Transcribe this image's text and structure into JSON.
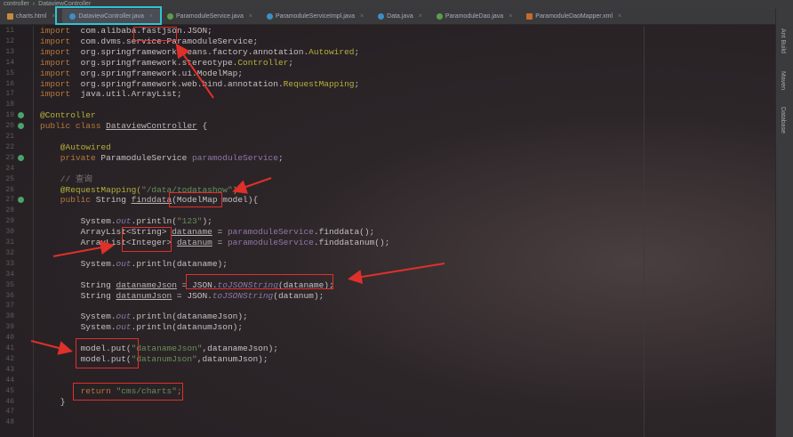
{
  "breadcrumb": [
    "controller",
    "DataviewController"
  ],
  "tabs": [
    {
      "label": "charts.html",
      "icon": "html-file-icon",
      "active": false
    },
    {
      "label": "DataviewController.java",
      "icon": "java-class-icon",
      "active": true
    },
    {
      "label": "ParamoduleService.java",
      "icon": "java-interface-icon",
      "active": false
    },
    {
      "label": "ParamoduleServiceImpl.java",
      "icon": "java-class-icon",
      "active": false
    },
    {
      "label": "Data.java",
      "icon": "java-class-icon",
      "active": false
    },
    {
      "label": "ParamoduleDao.java",
      "icon": "java-interface-icon",
      "active": false
    },
    {
      "label": "ParamoduleDaoMapper.xml",
      "icon": "xml-file-icon",
      "active": false
    }
  ],
  "right_tools": [
    "Ant Build",
    "Maven",
    "Database"
  ],
  "colors": {
    "highlight": "#e0302a",
    "tab_highlight": "#2fc4d2"
  },
  "code": [
    {
      "n": "11",
      "s": [
        [
          "kw",
          "import"
        ],
        [
          "",
          "  com.alibaba.fastjson.JSON;"
        ]
      ]
    },
    {
      "n": "12",
      "s": [
        [
          "kw",
          "import"
        ],
        [
          "",
          "  com.dvms.service.ParamoduleService;"
        ]
      ]
    },
    {
      "n": "13",
      "s": [
        [
          "kw",
          "import"
        ],
        [
          "",
          "  org.springframework.beans.factory.annotation."
        ],
        [
          "an",
          "Autowired"
        ],
        [
          "",
          ";"
        ]
      ]
    },
    {
      "n": "14",
      "s": [
        [
          "kw",
          "import"
        ],
        [
          "",
          "  org.springframework.stereotype."
        ],
        [
          "an",
          "Controller"
        ],
        [
          "",
          ";"
        ]
      ]
    },
    {
      "n": "15",
      "s": [
        [
          "kw",
          "import"
        ],
        [
          "",
          "  org.springframework.ui.ModelMap;"
        ]
      ]
    },
    {
      "n": "16",
      "s": [
        [
          "kw",
          "import"
        ],
        [
          "",
          "  org.springframework.web.bind.annotation."
        ],
        [
          "an",
          "RequestMapping"
        ],
        [
          "",
          ";"
        ]
      ]
    },
    {
      "n": "17",
      "s": [
        [
          "kw",
          "import"
        ],
        [
          "",
          "  java.util.ArrayList;"
        ]
      ]
    },
    {
      "n": "18",
      "s": []
    },
    {
      "n": "19",
      "g": true,
      "s": [
        [
          "an",
          "@Controller"
        ]
      ]
    },
    {
      "n": "20",
      "g": true,
      "s": [
        [
          "kw",
          "public class"
        ],
        [
          "",
          " "
        ],
        [
          "ul",
          "DataviewController"
        ],
        [
          "",
          " {"
        ]
      ]
    },
    {
      "n": "21",
      "s": []
    },
    {
      "n": "22",
      "s": [
        [
          "an",
          "    @Autowired"
        ]
      ]
    },
    {
      "n": "23",
      "g": true,
      "s": [
        [
          "kw",
          "    private"
        ],
        [
          "",
          " ParamoduleService "
        ],
        [
          "fld",
          "paramoduleService"
        ],
        [
          "",
          ";"
        ]
      ]
    },
    {
      "n": "24",
      "s": []
    },
    {
      "n": "25",
      "s": [
        [
          "cm",
          "    // 查询"
        ]
      ]
    },
    {
      "n": "26",
      "s": [
        [
          "an",
          "    @RequestMapping("
        ],
        [
          "str",
          "\"/data/todatashow\""
        ],
        [
          "an",
          ")"
        ]
      ]
    },
    {
      "n": "27",
      "g": true,
      "s": [
        [
          "kw",
          "    public"
        ],
        [
          "",
          " String "
        ],
        [
          "ul",
          "finddata"
        ],
        [
          "",
          "(ModelMap model){"
        ]
      ]
    },
    {
      "n": "28",
      "s": []
    },
    {
      "n": "29",
      "s": [
        [
          "",
          "        System."
        ],
        [
          "it",
          "out"
        ],
        [
          "",
          ".println("
        ],
        [
          "str",
          "\"123\""
        ],
        [
          "",
          ");"
        ]
      ]
    },
    {
      "n": "30",
      "s": [
        [
          "",
          "        ArrayList<String> "
        ],
        [
          "ul",
          "dataname"
        ],
        [
          "",
          " = "
        ],
        [
          "fld",
          "paramoduleService"
        ],
        [
          "",
          ".finddata();"
        ]
      ]
    },
    {
      "n": "31",
      "s": [
        [
          "",
          "        ArrayList<Integer> "
        ],
        [
          "ul",
          "datanum"
        ],
        [
          "",
          " = "
        ],
        [
          "fld",
          "paramoduleService"
        ],
        [
          "",
          ".finddatanum();"
        ]
      ]
    },
    {
      "n": "32",
      "s": []
    },
    {
      "n": "33",
      "s": [
        [
          "",
          "        System."
        ],
        [
          "it",
          "out"
        ],
        [
          "",
          ".println(dataname);"
        ]
      ]
    },
    {
      "n": "34",
      "s": []
    },
    {
      "n": "35",
      "s": [
        [
          "",
          "        String "
        ],
        [
          "ul",
          "datanameJson"
        ],
        [
          "",
          " = JSON."
        ],
        [
          "it",
          "toJSONString"
        ],
        [
          "",
          "(dataname);"
        ]
      ]
    },
    {
      "n": "36",
      "s": [
        [
          "",
          "        String "
        ],
        [
          "ul",
          "datanumJson"
        ],
        [
          "",
          " = JSON."
        ],
        [
          "it",
          "toJSONString"
        ],
        [
          "",
          "(datanum);"
        ]
      ]
    },
    {
      "n": "37",
      "s": []
    },
    {
      "n": "38",
      "s": [
        [
          "",
          "        System."
        ],
        [
          "it",
          "out"
        ],
        [
          "",
          ".println(datanameJson);"
        ]
      ]
    },
    {
      "n": "39",
      "s": [
        [
          "",
          "        System."
        ],
        [
          "it",
          "out"
        ],
        [
          "",
          ".println(datanumJson);"
        ]
      ]
    },
    {
      "n": "40",
      "s": []
    },
    {
      "n": "41",
      "s": [
        [
          "",
          "        model.put("
        ],
        [
          "str",
          "\"datanameJson\""
        ],
        [
          "",
          ",datanameJson);"
        ]
      ]
    },
    {
      "n": "42",
      "s": [
        [
          "",
          "        model.put("
        ],
        [
          "str",
          "\"datanumJson\""
        ],
        [
          "",
          ",datanumJson);"
        ]
      ]
    },
    {
      "n": "43",
      "s": []
    },
    {
      "n": "44",
      "s": []
    },
    {
      "n": "45",
      "s": [
        [
          "kw",
          "        return "
        ],
        [
          "str",
          "\"cms/charts\""
        ],
        [
          "kw",
          ";"
        ]
      ]
    },
    {
      "n": "46",
      "s": [
        [
          "",
          "    }"
        ]
      ]
    },
    {
      "n": "47",
      "s": []
    },
    {
      "n": "48",
      "s": []
    }
  ]
}
